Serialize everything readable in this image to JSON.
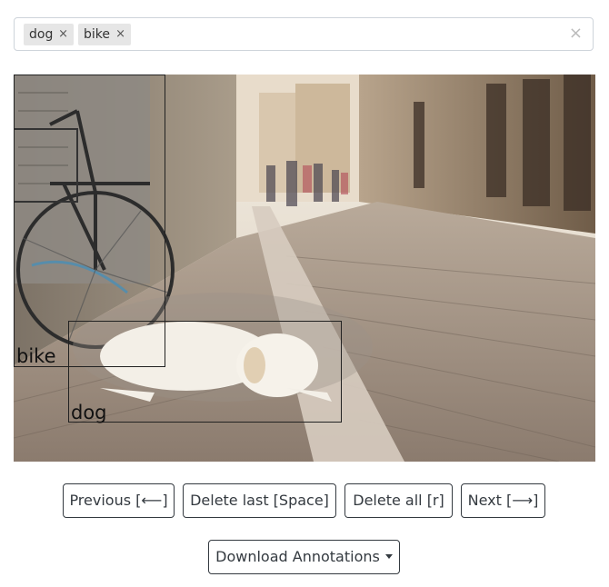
{
  "tags": {
    "items": [
      {
        "label": "dog",
        "remove": "×"
      },
      {
        "label": "bike",
        "remove": "×"
      }
    ],
    "clear": "×"
  },
  "annotations": [
    {
      "label": "bike"
    },
    {
      "label": "dog"
    }
  ],
  "buttons": {
    "previous": "Previous [⟵]",
    "delete_last": "Delete last [Space]",
    "delete_all": "Delete all [r]",
    "next": "Next [⟶]",
    "download": "Download Annotations"
  }
}
